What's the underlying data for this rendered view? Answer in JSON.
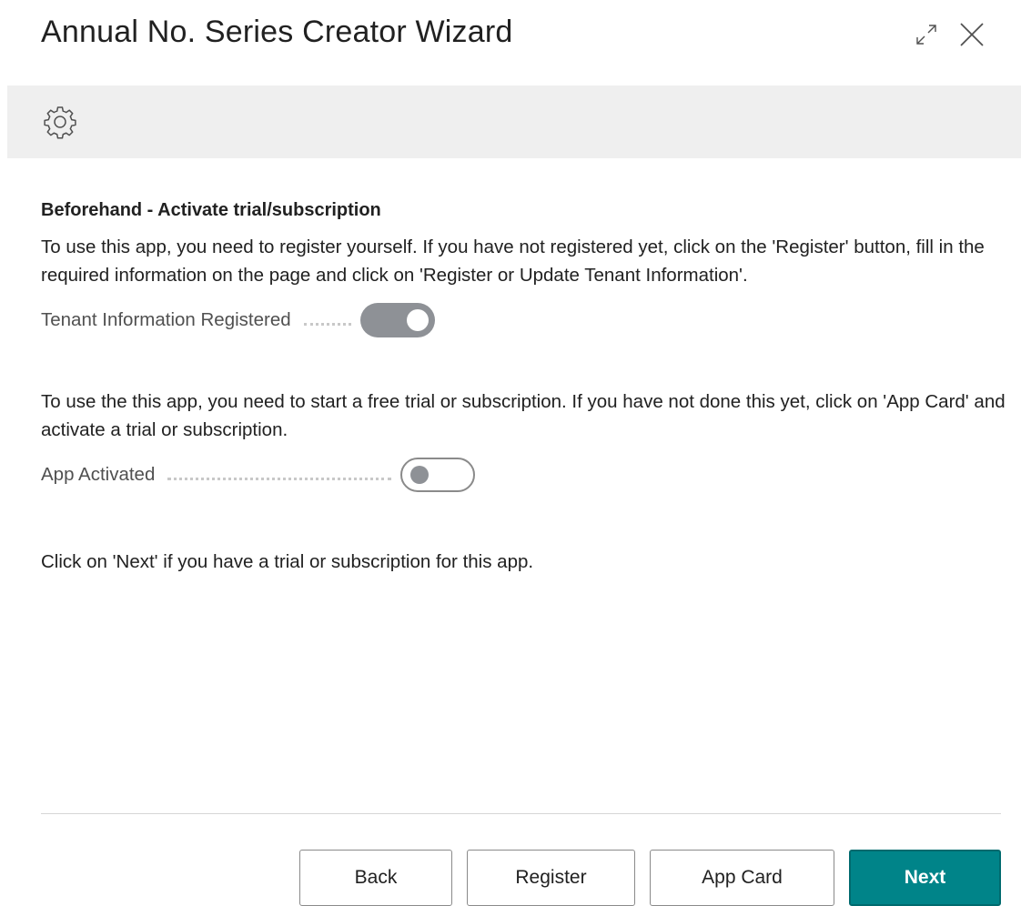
{
  "window": {
    "title": "Annual No. Series Creator Wizard",
    "expand_icon": "expand-icon",
    "close_icon": "close-icon"
  },
  "banner": {
    "icon": "gear-icon"
  },
  "step": {
    "heading": "Beforehand - Activate trial/subscription",
    "register_text": "To use this app, you need to register yourself. If you have not registered yet, click on the 'Register' button, fill in the required information on the page and click on 'Register or Update Tenant Information'.",
    "tenant_field": {
      "label": "Tenant Information Registered",
      "value": true
    },
    "activate_text": "To use the this app, you need to start a free trial or subscription. If you have not done this yet, click on 'App Card' and activate a trial or subscription.",
    "app_field": {
      "label": "App Activated",
      "value": false
    },
    "next_text": "Click on 'Next' if you have a trial or subscription for this app."
  },
  "footer": {
    "back_label": "Back",
    "register_label": "Register",
    "app_card_label": "App Card",
    "next_label": "Next"
  },
  "colors": {
    "accent": "#008489",
    "banner_bg": "#efefef",
    "toggle_on": "#8e9196"
  }
}
